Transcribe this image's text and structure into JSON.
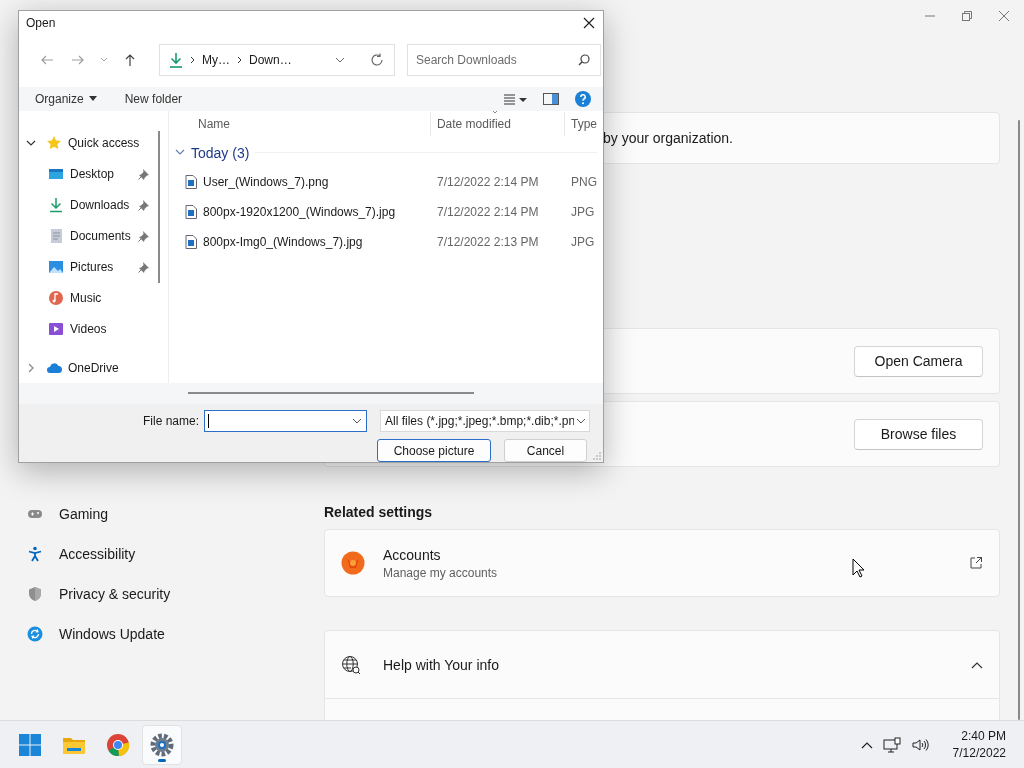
{
  "settings": {
    "notice": "by your organization.",
    "nav_items": [
      {
        "kind": "gaming",
        "label": "Gaming"
      },
      {
        "kind": "accessibility",
        "label": "Accessibility"
      },
      {
        "kind": "privacy",
        "label": "Privacy & security"
      },
      {
        "kind": "update",
        "label": "Windows Update"
      }
    ],
    "photo_cards": [
      {
        "button": "Open Camera"
      },
      {
        "button": "Browse files"
      }
    ],
    "related_heading": "Related settings",
    "related": [
      {
        "kind": "link",
        "title": "Accounts",
        "subtitle": "Manage my accounts"
      },
      {
        "kind": "expander",
        "title": "Help with Your info",
        "expanded": true
      }
    ]
  },
  "dialog": {
    "title": "Open",
    "breadcrumb": [
      "My…",
      "Down…"
    ],
    "search": {
      "placeholder": "Search Downloads"
    },
    "commands": [
      {
        "label": "Organize",
        "menu": true
      },
      {
        "label": "New folder",
        "menu": false
      }
    ],
    "nav": [
      {
        "kind": "star",
        "label": "Quick access",
        "expanded": true,
        "children": [
          {
            "kind": "desktop",
            "label": "Desktop",
            "pinned": true
          },
          {
            "kind": "download",
            "label": "Downloads",
            "pinned": true
          },
          {
            "kind": "document",
            "label": "Documents",
            "pinned": true
          },
          {
            "kind": "pictures",
            "label": "Pictures",
            "pinned": true
          },
          {
            "kind": "music",
            "label": "Music",
            "pinned": false
          },
          {
            "kind": "videos",
            "label": "Videos",
            "pinned": false
          }
        ]
      },
      {
        "kind": "cloud",
        "label": "OneDrive",
        "expanded": false
      }
    ],
    "columns": [
      "Name",
      "Date modified",
      "Type"
    ],
    "group": {
      "label": "Today (3)",
      "expanded": true
    },
    "files": [
      {
        "name": "User_(Windows_7).png",
        "date": "7/12/2022 2:14 PM",
        "type": "PNG"
      },
      {
        "name": "800px-1920x1200_(Windows_7).jpg",
        "date": "7/12/2022 2:14 PM",
        "type": "JPG"
      },
      {
        "name": "800px-Img0_(Windows_7).jpg",
        "date": "7/12/2022 2:13 PM",
        "type": "JPG"
      }
    ],
    "file_name_label": "File name:",
    "filter": "All files (*.jpg;*.jpeg;*.bmp;*.dib;*.pn",
    "buttons": [
      {
        "label": "Choose picture",
        "default": true
      },
      {
        "label": "Cancel",
        "default": false
      }
    ]
  },
  "taskbar": {
    "apps": [
      {
        "kind": "start",
        "selected": false
      },
      {
        "kind": "folder",
        "selected": false
      },
      {
        "kind": "browser",
        "selected": false
      },
      {
        "kind": "settings",
        "selected": true
      }
    ],
    "time": "2:40 PM",
    "date": "7/12/2022"
  }
}
